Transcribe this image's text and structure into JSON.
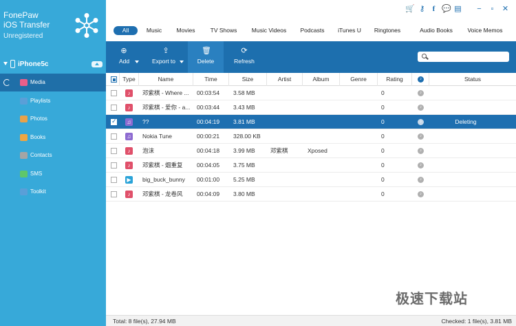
{
  "app": {
    "name_line1": "FonePaw",
    "name_line2": "iOS Transfer",
    "registration": "Unregistered"
  },
  "device": {
    "name": "iPhone5c"
  },
  "sidebar": {
    "items": [
      {
        "label": "Media",
        "icon": "music-note-icon",
        "color": "#ea5f8a",
        "active": true
      },
      {
        "label": "Playlists",
        "icon": "playlist-icon",
        "color": "#5a9fd8"
      },
      {
        "label": "Photos",
        "icon": "photos-icon",
        "color": "#e8a24a"
      },
      {
        "label": "Books",
        "icon": "book-icon",
        "color": "#f0a641"
      },
      {
        "label": "Contacts",
        "icon": "contacts-icon",
        "color": "#a5a5a5"
      },
      {
        "label": "SMS",
        "icon": "sms-icon",
        "color": "#5fc76b"
      },
      {
        "label": "Toolkit",
        "icon": "toolkit-icon",
        "color": "#5a9fd8"
      }
    ]
  },
  "titlebar": {
    "icons": [
      "cart-icon",
      "key-icon",
      "facebook-icon",
      "feedback-icon",
      "menu-icon",
      "minimize-icon",
      "maximize-icon",
      "close-icon"
    ]
  },
  "tabs": [
    {
      "label": "All",
      "active": true
    },
    {
      "label": "Music"
    },
    {
      "label": "Movies"
    },
    {
      "label": "TV Shows"
    },
    {
      "label": "Music Videos"
    },
    {
      "label": "Podcasts"
    },
    {
      "label": "iTunes U"
    },
    {
      "label": "Ringtones"
    },
    {
      "label": "Audio Books"
    },
    {
      "label": "Voice Memos"
    }
  ],
  "toolbar": {
    "add_label": "Add",
    "export_label": "Export to",
    "delete_label": "Delete",
    "refresh_label": "Refresh",
    "search_placeholder": ""
  },
  "table": {
    "columns": [
      "Type",
      "Name",
      "Time",
      "Size",
      "Artist",
      "Album",
      "Genre",
      "Rating",
      "Status"
    ],
    "rows": [
      {
        "checked": false,
        "type": "music",
        "name": "邓紫棋 - Where ...",
        "time": "00:03:54",
        "size": "3.58 MB",
        "artist": "",
        "album": "",
        "genre": "",
        "rating": "0",
        "status": ""
      },
      {
        "checked": false,
        "type": "music",
        "name": "邓紫棋 - 爱你 - a...",
        "time": "00:03:44",
        "size": "3.43 MB",
        "artist": "",
        "album": "",
        "genre": "",
        "rating": "0",
        "status": ""
      },
      {
        "checked": true,
        "type": "ringtone",
        "name": "??",
        "time": "00:04:19",
        "size": "3.81 MB",
        "artist": "",
        "album": "",
        "genre": "",
        "rating": "0",
        "status": "Deleting",
        "selected": true
      },
      {
        "checked": false,
        "type": "ringtone",
        "name": "Nokia Tune",
        "time": "00:00:21",
        "size": "328.00 KB",
        "artist": "",
        "album": "",
        "genre": "",
        "rating": "0",
        "status": ""
      },
      {
        "checked": false,
        "type": "music",
        "name": "泡沫",
        "time": "00:04:18",
        "size": "3.99 MB",
        "artist": "邓紫棋",
        "album": "Xposed",
        "genre": "",
        "rating": "0",
        "status": ""
      },
      {
        "checked": false,
        "type": "music",
        "name": "邓紫棋 - 烟重复",
        "time": "00:04:05",
        "size": "3.75 MB",
        "artist": "",
        "album": "",
        "genre": "",
        "rating": "0",
        "status": ""
      },
      {
        "checked": false,
        "type": "movie",
        "name": "big_buck_bunny",
        "time": "00:01:00",
        "size": "5.25 MB",
        "artist": "",
        "album": "",
        "genre": "",
        "rating": "0",
        "status": ""
      },
      {
        "checked": false,
        "type": "music",
        "name": "邓紫棋 - 龙卷风",
        "time": "00:04:09",
        "size": "3.80 MB",
        "artist": "",
        "album": "",
        "genre": "",
        "rating": "0",
        "status": ""
      }
    ]
  },
  "status": {
    "total": "Total: 8 file(s), 27.94 MB",
    "checked": "Checked: 1 file(s), 3.81 MB"
  },
  "watermark": "极速下载站",
  "colors": {
    "sidebar": "#37a9d9",
    "accent": "#1e6fb0",
    "toolbar": "#1d6fae",
    "music_icon": "#e0506a",
    "ringtone_icon": "#8e6bd1",
    "movie_icon": "#2aa3d8"
  }
}
